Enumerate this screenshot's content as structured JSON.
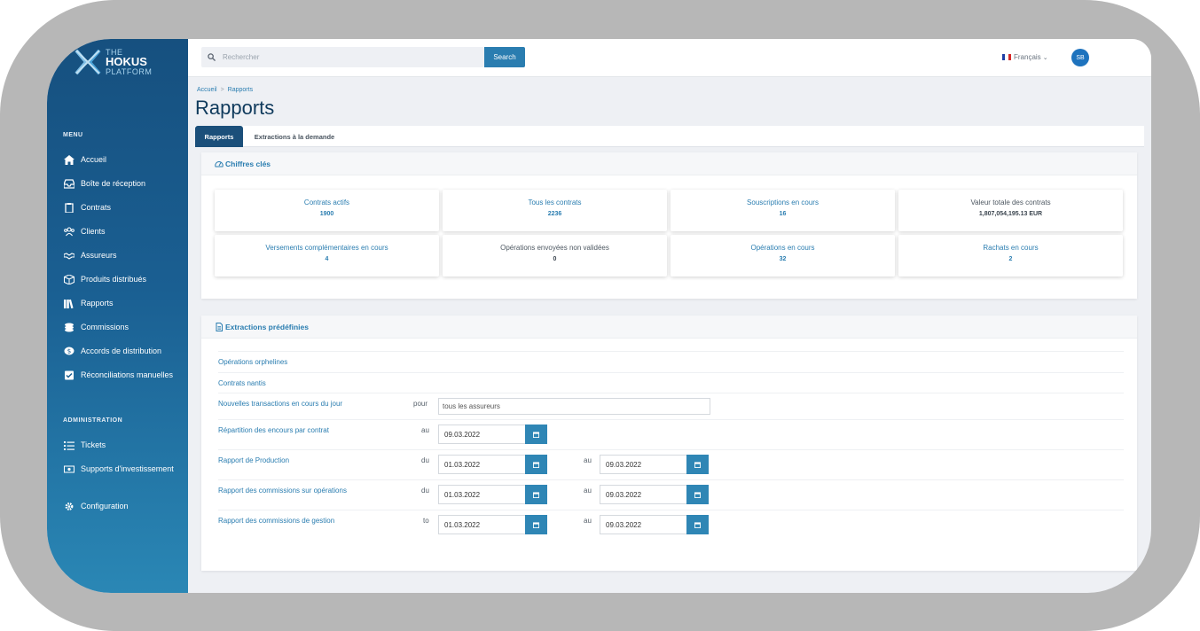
{
  "brand": {
    "line1": "THE",
    "line2": "HOKUS",
    "line3": "PLATFORM"
  },
  "colors": {
    "sidebar": "#1a5f92",
    "accent": "#2a7db0",
    "title": "#0f3a5c",
    "tab_active": "#1b4f7a"
  },
  "sidebar": {
    "menu_title": "MENU",
    "items": [
      {
        "label": "Accueil",
        "icon": "home-icon"
      },
      {
        "label": "Boîte de réception",
        "icon": "inbox-icon"
      },
      {
        "label": "Contrats",
        "icon": "clipboard-icon"
      },
      {
        "label": "Clients",
        "icon": "users-icon"
      },
      {
        "label": "Assureurs",
        "icon": "handshake-icon"
      },
      {
        "label": "Produits distribués",
        "icon": "box-icon"
      },
      {
        "label": "Rapports",
        "icon": "books-icon"
      },
      {
        "label": "Commissions",
        "icon": "coins-icon"
      },
      {
        "label": "Accords de distribution",
        "icon": "comment-dollar-icon"
      },
      {
        "label": "Réconciliations manuelles",
        "icon": "checkbox-icon"
      }
    ],
    "admin_title": "ADMINISTRATION",
    "admin_items": [
      {
        "label": "Tickets",
        "icon": "tasks-icon"
      },
      {
        "label": "Supports d'investissement",
        "icon": "money-bill-icon"
      },
      {
        "label": "Configuration",
        "icon": "gear-icon"
      }
    ]
  },
  "topbar": {
    "search_placeholder": "Rechercher",
    "search_button": "Search",
    "language": "Français",
    "avatar_initials": "SB"
  },
  "breadcrumb": [
    "Accueil",
    "Rapports"
  ],
  "page_title": "Rapports",
  "tabs": [
    {
      "label": "Rapports"
    },
    {
      "label": "Extractions à la demande"
    }
  ],
  "key_figures": {
    "title": "Chiffres clés",
    "cards": [
      {
        "label": "Contrats actifs",
        "value": "1900"
      },
      {
        "label": "Tous les contrats",
        "value": "2236"
      },
      {
        "label": "Souscriptions en cours",
        "value": "16"
      },
      {
        "label": "Valeur totale des contrats",
        "value": "1,807,054,195.13 EUR"
      },
      {
        "label": "Versements complémentaires en cours",
        "value": "4"
      },
      {
        "label": "Opérations envoyées non validées",
        "value": "0"
      },
      {
        "label": "Opérations en cours",
        "value": "32"
      },
      {
        "label": "Rachats en cours",
        "value": "2"
      }
    ]
  },
  "extractions": {
    "title": "Extractions prédéfinies",
    "rows": [
      {
        "label": "Opérations orphelines"
      },
      {
        "label": "Contrats nantis"
      },
      {
        "label": "Nouvelles transactions en cours du jour",
        "prefix": "pour",
        "input_value": "tous les assureurs"
      },
      {
        "label": "Répartition des encours par contrat",
        "prefix": "au",
        "date1": "09.03.2022"
      },
      {
        "label": "Rapport de Production",
        "prefix": "du",
        "date1": "01.03.2022",
        "mid": "au",
        "date2": "09.03.2022"
      },
      {
        "label": "Rapport des commissions sur opérations",
        "prefix": "du",
        "date1": "01.03.2022",
        "mid": "au",
        "date2": "09.03.2022"
      },
      {
        "label": "Rapport des commissions de gestion",
        "prefix": "to",
        "date1": "01.03.2022",
        "mid": "au",
        "date2": "09.03.2022"
      }
    ]
  }
}
